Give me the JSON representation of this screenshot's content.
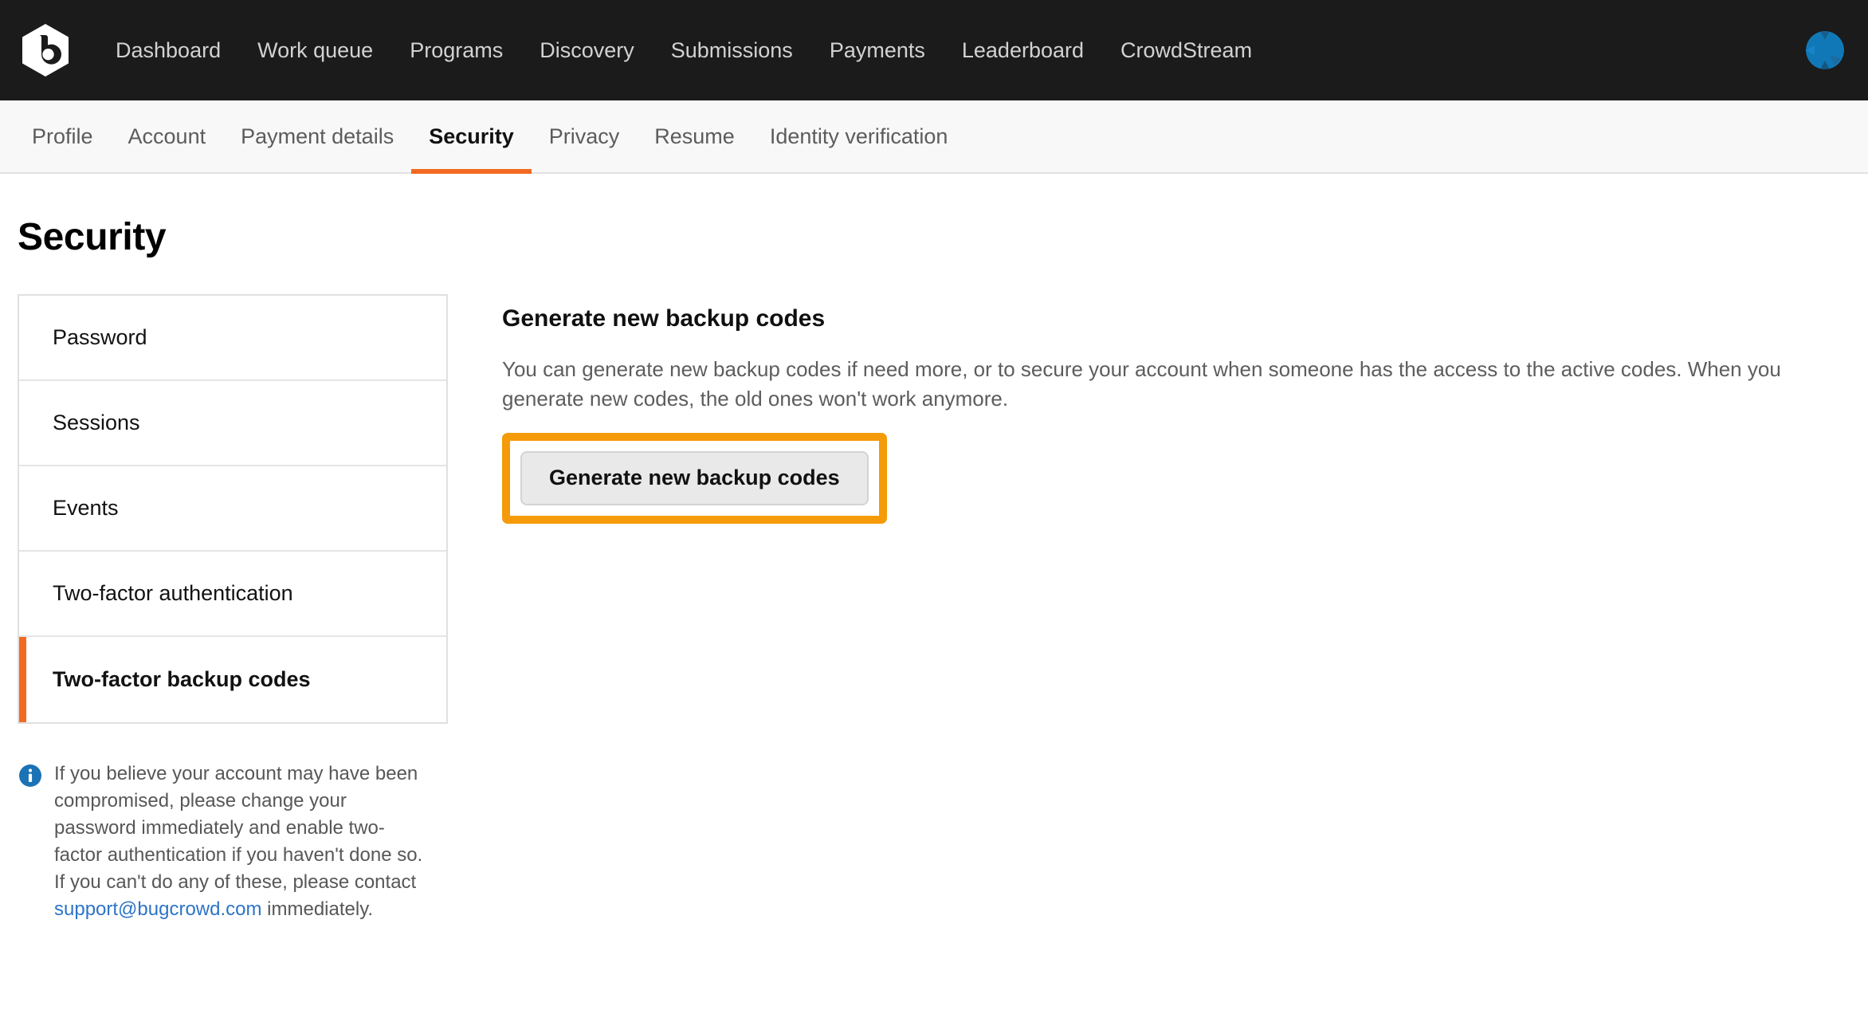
{
  "topnav": {
    "logo_alt": "bugcrowd-logo",
    "links": [
      {
        "label": "Dashboard"
      },
      {
        "label": "Work queue"
      },
      {
        "label": "Programs"
      },
      {
        "label": "Discovery"
      },
      {
        "label": "Submissions"
      },
      {
        "label": "Payments"
      },
      {
        "label": "Leaderboard"
      },
      {
        "label": "CrowdStream"
      }
    ],
    "avatar_alt": "user-avatar",
    "background": "#1b1b1b",
    "link_color": "#d2d2d2",
    "avatar_color": "#1178b8"
  },
  "tabbar": {
    "tabs": [
      {
        "label": "Profile",
        "active": false
      },
      {
        "label": "Account",
        "active": false
      },
      {
        "label": "Payment details",
        "active": false
      },
      {
        "label": "Security",
        "active": true
      },
      {
        "label": "Privacy",
        "active": false
      },
      {
        "label": "Resume",
        "active": false
      },
      {
        "label": "Identity verification",
        "active": false
      }
    ],
    "accent": "#f26a21",
    "background": "#f8f8f8"
  },
  "page": {
    "title": "Security"
  },
  "sidebar": {
    "items": [
      {
        "label": "Password",
        "active": false
      },
      {
        "label": "Sessions",
        "active": false
      },
      {
        "label": "Events",
        "active": false
      },
      {
        "label": "Two-factor authentication",
        "active": false
      },
      {
        "label": "Two-factor backup codes",
        "active": true
      }
    ],
    "active_marker_color": "#f26a21"
  },
  "notice": {
    "icon": "info-icon",
    "icon_color": "#1b72b5",
    "text_before_link": "If you believe your account may have been compromised, please change your password immediately and enable two-factor authentication if you haven't done so. If you can't do any of these, please contact ",
    "link_text": "support@bugcrowd.com",
    "link_color": "#2d74c7",
    "text_after_link": " immediately."
  },
  "main": {
    "heading": "Generate new backup codes",
    "description": "You can generate new backup codes if need more, or to secure your account when someone has the access to the active codes. When you generate new codes, the old ones won't work anymore.",
    "button_label": "Generate new backup codes",
    "highlight_color": "#f59b09"
  }
}
